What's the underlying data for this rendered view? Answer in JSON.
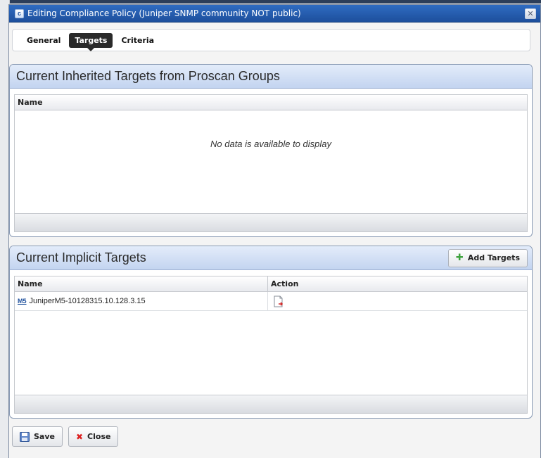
{
  "dialog": {
    "title": "Editing Compliance Policy (Juniper SNMP community NOT public)",
    "title_icon_glyph": "c",
    "close_glyph": "✕"
  },
  "tabs": [
    {
      "label": "General",
      "active": false
    },
    {
      "label": "Targets",
      "active": true
    },
    {
      "label": "Criteria",
      "active": false
    }
  ],
  "inherited": {
    "title": "Current Inherited Targets from Proscan Groups",
    "columns": [
      "Name"
    ],
    "empty_message": "No data is available to display"
  },
  "implicit": {
    "title": "Current Implicit Targets",
    "add_button_label": "Add Targets",
    "columns": [
      "Name",
      "Action"
    ],
    "rows": [
      {
        "icon_text": "M5",
        "name": "JuniperM5-10128315.10.128.3.15",
        "action_icon": "document-remove-icon"
      }
    ]
  },
  "footer": {
    "save_label": "Save",
    "close_label": "Close"
  },
  "colors": {
    "title_bar": "#1d4f9c",
    "panel_header": "#c3d4f0",
    "active_tab": "#2a2a2a",
    "add_icon": "#3ea23e",
    "close_icon": "#dd2222"
  }
}
